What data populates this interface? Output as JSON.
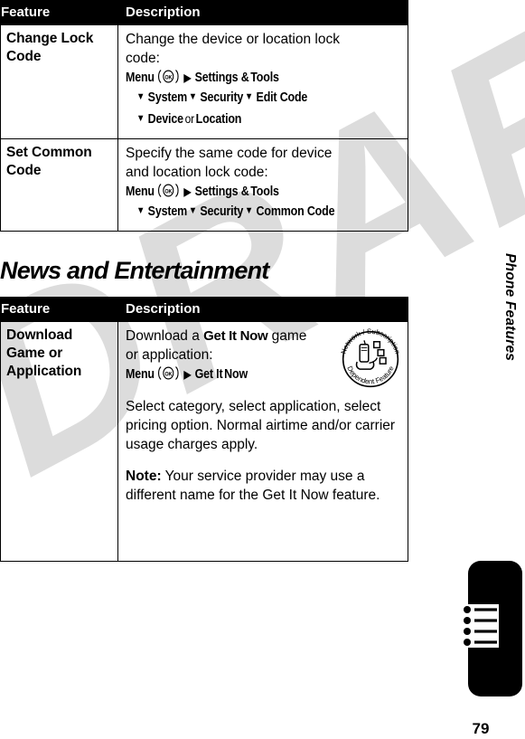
{
  "document": {
    "page_number": "79",
    "side_tab_label": "Phone Features",
    "watermark": "DRAFT"
  },
  "tables": [
    {
      "id": "security-table",
      "headers": {
        "feature": "Feature",
        "description": "Description"
      },
      "rows": [
        {
          "feature": "Change Lock Code",
          "desc_line1": "Change the device or location lock",
          "desc_line2": "code:",
          "menupath": [
            {
              "indent": false,
              "parts": [
                {
                  "type": "bold",
                  "text": "Menu"
                },
                {
                  "type": "okkey"
                },
                {
                  "type": "tri-right"
                },
                {
                  "type": "bold",
                  "text": "Settings &"
                },
                {
                  "type": "bold",
                  "text": "Tools"
                }
              ]
            },
            {
              "indent": true,
              "parts": [
                {
                  "type": "tri-down"
                },
                {
                  "type": "bold",
                  "text": "System"
                },
                {
                  "type": "tri-down"
                },
                {
                  "type": "bold",
                  "text": "Security"
                },
                {
                  "type": "tri-down"
                },
                {
                  "type": "bold",
                  "text": "Edit Code"
                }
              ]
            },
            {
              "indent": true,
              "parts": [
                {
                  "type": "tri-down"
                },
                {
                  "type": "bold",
                  "text": "Device"
                },
                {
                  "type": "plain",
                  "text": "or"
                },
                {
                  "type": "bold",
                  "text": "Location"
                }
              ]
            }
          ]
        },
        {
          "feature": "Set Common Code",
          "desc_line1": "Specify the same code for device",
          "desc_line2": "and location lock code:",
          "menupath": [
            {
              "indent": false,
              "parts": [
                {
                  "type": "bold",
                  "text": "Menu"
                },
                {
                  "type": "okkey"
                },
                {
                  "type": "tri-right"
                },
                {
                  "type": "bold",
                  "text": "Settings &"
                },
                {
                  "type": "bold",
                  "text": "Tools"
                }
              ]
            },
            {
              "indent": true,
              "parts": [
                {
                  "type": "tri-down"
                },
                {
                  "type": "bold",
                  "text": "System"
                },
                {
                  "type": "tri-down"
                },
                {
                  "type": "bold",
                  "text": "Security"
                },
                {
                  "type": "tri-down"
                },
                {
                  "type": "bold",
                  "text": "Common Code"
                }
              ]
            }
          ]
        }
      ]
    }
  ],
  "section": {
    "heading": "News and Entertainment",
    "table": {
      "id": "news-table",
      "headers": {
        "feature": "Feature",
        "description": "Description"
      },
      "row": {
        "feature": "Download Game or Application",
        "desc_line1_a": "Download a ",
        "desc_line1_b": "Get It Now",
        "desc_line1_c": " game",
        "desc_line2": "or application:",
        "menupath": [
          {
            "indent": false,
            "parts": [
              {
                "type": "bold",
                "text": "Menu"
              },
              {
                "type": "okkey"
              },
              {
                "type": "tri-right"
              },
              {
                "type": "bold",
                "text": "Get It"
              },
              {
                "type": "bold",
                "text": "Now"
              }
            ]
          }
        ],
        "paragraph": "Select category, select application, select pricing option. Normal airtime and/or carrier usage charges apply.",
        "note_label": "Note:",
        "note_text": " Your service provider may use a different name for the Get It Now feature.",
        "badge": {
          "top_text": "Network / Subscription",
          "bottom_text": "Dependent Feature",
          "name": "network-subscription-dependent-feature-icon"
        }
      }
    }
  },
  "colors": {
    "header_bg": "#000000",
    "header_text": "#ffffff",
    "body_text": "#000000",
    "border": "#000000",
    "watermark": "#dcdcdc"
  }
}
